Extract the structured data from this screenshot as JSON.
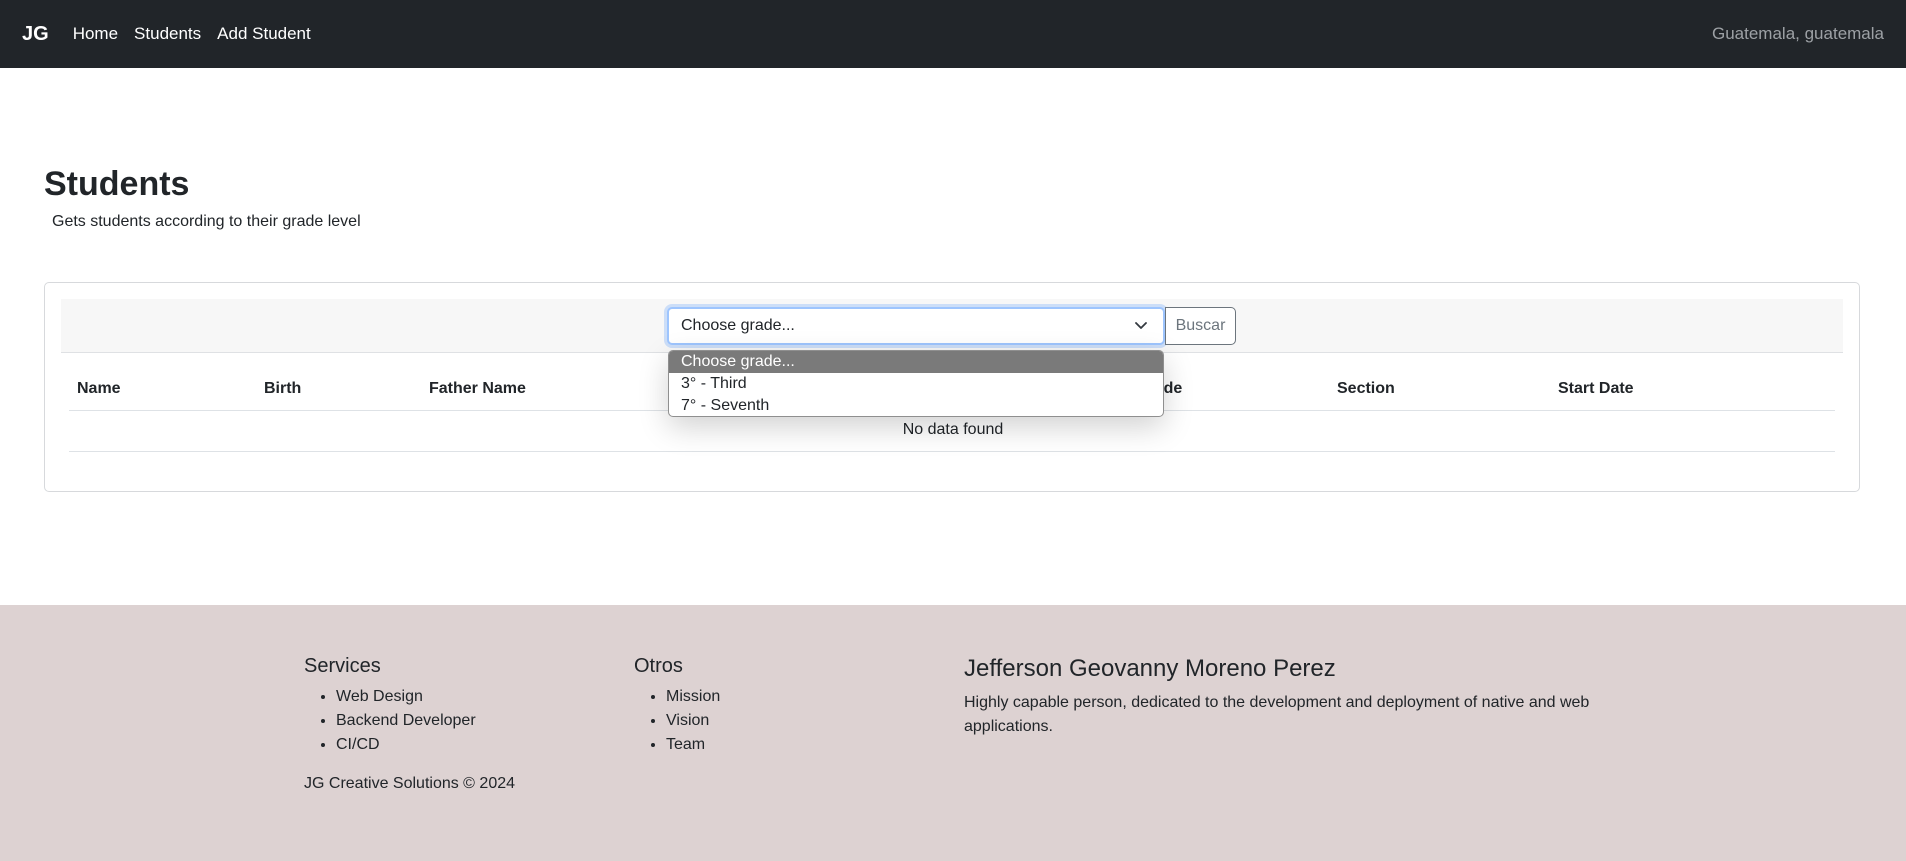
{
  "navbar": {
    "brand": "JG",
    "links": [
      "Home",
      "Students",
      "Add Student"
    ],
    "location": "Guatemala, guatemala"
  },
  "page": {
    "title": "Students",
    "subtitle": "Gets students according to their grade level"
  },
  "filter": {
    "select_value": "Choose grade...",
    "button_label": "Buscar",
    "options": [
      "Choose grade...",
      "3° - Third",
      "7° - Seventh"
    ],
    "selected_index": 0
  },
  "table": {
    "columns": [
      "Name",
      "Birth",
      "Father Name",
      "Grade",
      "Section",
      "Start Date"
    ],
    "empty_text": "No data found"
  },
  "footer": {
    "services_title": "Services",
    "services": [
      "Web Design",
      "Backend Developer",
      "CI/CD"
    ],
    "otros_title": "Otros",
    "otros": [
      "Mission",
      "Vision",
      "Team"
    ],
    "person_name": "Jefferson Geovanny Moreno Perez",
    "person_desc": "Highly capable person, dedicated to the development and deployment of native and web applications.",
    "copyright": "JG Creative Solutions © 2024"
  },
  "colors": {
    "navbar_bg": "#212529",
    "footer_bg": "#ddd2d2",
    "selected_option_bg": "#7a7a7a",
    "focus_ring": "#9ec5fe"
  },
  "icons": {
    "select_caret": "chevron-down-icon"
  }
}
